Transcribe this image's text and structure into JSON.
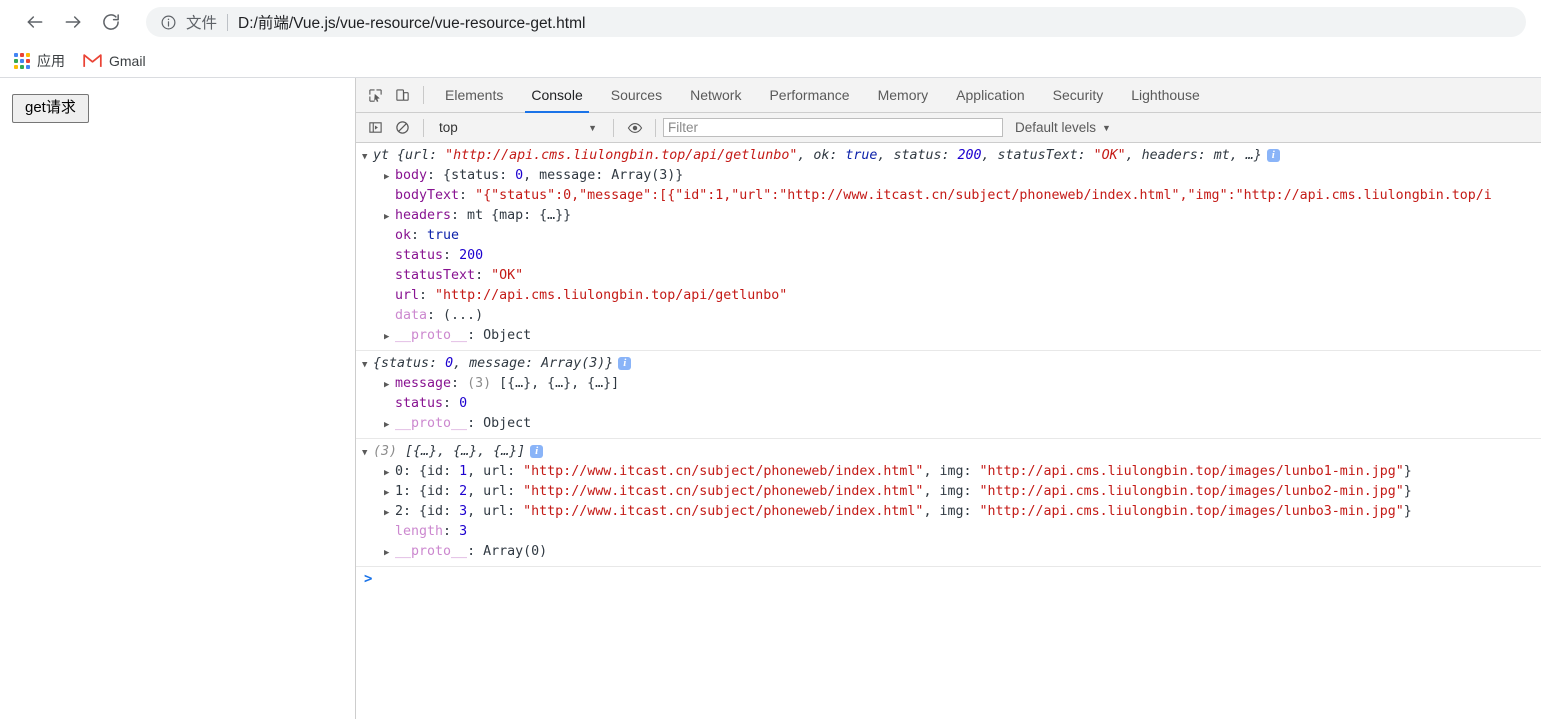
{
  "browser": {
    "nav": {
      "back_icon": "arrow-left-icon",
      "forward_icon": "arrow-right-icon",
      "reload_icon": "reload-icon"
    },
    "omnibox": {
      "info_icon": "info-circle-icon",
      "scheme_label": "文件",
      "url": "D:/前端/Vue.js/vue-resource/vue-resource-get.html"
    },
    "bookmarks": [
      {
        "icon": "apps-grid-icon",
        "label": "应用"
      },
      {
        "icon": "gmail-icon",
        "label": "Gmail"
      }
    ]
  },
  "page": {
    "button_label": "get请求"
  },
  "devtools": {
    "icons": {
      "inspect": "inspect-element-icon",
      "device": "device-toolbar-icon",
      "sidebar": "console-sidebar-icon",
      "clear": "clear-console-icon",
      "eye": "eye-icon"
    },
    "tabs": [
      {
        "label": "Elements",
        "active": false
      },
      {
        "label": "Console",
        "active": true
      },
      {
        "label": "Sources",
        "active": false
      },
      {
        "label": "Network",
        "active": false
      },
      {
        "label": "Performance",
        "active": false
      },
      {
        "label": "Memory",
        "active": false
      },
      {
        "label": "Application",
        "active": false
      },
      {
        "label": "Security",
        "active": false
      },
      {
        "label": "Lighthouse",
        "active": false
      }
    ],
    "filterbar": {
      "context": "top",
      "context_caret": "▼",
      "filter_placeholder": "Filter",
      "filter_value": "",
      "levels_label": "Default levels",
      "levels_caret": "▼"
    },
    "console": {
      "prompt_chevron": ">",
      "info_badge": "i",
      "groups": [
        {
          "header": {
            "triangle": "open",
            "name": "yt",
            "summary_parts": [
              {
                "text": "{",
                "cls": "t-plain t-ital"
              },
              {
                "text": "url",
                "cls": "t-plain t-ital"
              },
              {
                "text": ": ",
                "cls": "t-plain t-ital"
              },
              {
                "text": "\"http://api.cms.liulongbin.top/api/getlunbo\"",
                "cls": "t-str t-ital"
              },
              {
                "text": ", ",
                "cls": "t-plain t-ital"
              },
              {
                "text": "ok",
                "cls": "t-plain t-ital"
              },
              {
                "text": ": ",
                "cls": "t-plain t-ital"
              },
              {
                "text": "true",
                "cls": "t-bool t-ital"
              },
              {
                "text": ", ",
                "cls": "t-plain t-ital"
              },
              {
                "text": "status",
                "cls": "t-plain t-ital"
              },
              {
                "text": ": ",
                "cls": "t-plain t-ital"
              },
              {
                "text": "200",
                "cls": "t-num t-ital"
              },
              {
                "text": ", ",
                "cls": "t-plain t-ital"
              },
              {
                "text": "statusText",
                "cls": "t-plain t-ital"
              },
              {
                "text": ": ",
                "cls": "t-plain t-ital"
              },
              {
                "text": "\"OK\"",
                "cls": "t-str t-ital"
              },
              {
                "text": ", ",
                "cls": "t-plain t-ital"
              },
              {
                "text": "headers",
                "cls": "t-plain t-ital"
              },
              {
                "text": ": mt, …}",
                "cls": "t-plain t-ital"
              }
            ],
            "has_badge": true
          },
          "rows": [
            {
              "triangle": "closed",
              "parts": [
                {
                  "text": "body",
                  "cls": "t-prop"
                },
                {
                  "text": ": {",
                  "cls": "t-plain"
                },
                {
                  "text": "status",
                  "cls": "t-plain"
                },
                {
                  "text": ": ",
                  "cls": "t-plain"
                },
                {
                  "text": "0",
                  "cls": "t-num"
                },
                {
                  "text": ", ",
                  "cls": "t-plain"
                },
                {
                  "text": "message",
                  "cls": "t-plain"
                },
                {
                  "text": ": Array(3)}",
                  "cls": "t-plain"
                }
              ]
            },
            {
              "triangle": "blank",
              "parts": [
                {
                  "text": "bodyText",
                  "cls": "t-prop"
                },
                {
                  "text": ": ",
                  "cls": "t-plain"
                },
                {
                  "text": "\"{\"status\":0,\"message\":[{\"id\":1,\"url\":\"http://www.itcast.cn/subject/phoneweb/index.html\",\"img\":\"http://api.cms.liulongbin.top/i",
                  "cls": "t-str"
                }
              ]
            },
            {
              "triangle": "closed",
              "parts": [
                {
                  "text": "headers",
                  "cls": "t-prop"
                },
                {
                  "text": ": mt {map: {…}}",
                  "cls": "t-plain"
                }
              ]
            },
            {
              "triangle": "blank",
              "parts": [
                {
                  "text": "ok",
                  "cls": "t-prop"
                },
                {
                  "text": ": ",
                  "cls": "t-plain"
                },
                {
                  "text": "true",
                  "cls": "t-bool"
                }
              ]
            },
            {
              "triangle": "blank",
              "parts": [
                {
                  "text": "status",
                  "cls": "t-prop"
                },
                {
                  "text": ": ",
                  "cls": "t-plain"
                },
                {
                  "text": "200",
                  "cls": "t-num"
                }
              ]
            },
            {
              "triangle": "blank",
              "parts": [
                {
                  "text": "statusText",
                  "cls": "t-prop"
                },
                {
                  "text": ": ",
                  "cls": "t-plain"
                },
                {
                  "text": "\"OK\"",
                  "cls": "t-str"
                }
              ]
            },
            {
              "triangle": "blank",
              "parts": [
                {
                  "text": "url",
                  "cls": "t-prop"
                },
                {
                  "text": ": ",
                  "cls": "t-plain"
                },
                {
                  "text": "\"http://api.cms.liulongbin.top/api/getlunbo\"",
                  "cls": "t-str"
                }
              ]
            },
            {
              "triangle": "blank",
              "parts": [
                {
                  "text": "data",
                  "cls": "t-prop-d"
                },
                {
                  "text": ": (...)",
                  "cls": "t-plain"
                }
              ]
            },
            {
              "triangle": "closed",
              "parts": [
                {
                  "text": "__proto__",
                  "cls": "t-prop-d"
                },
                {
                  "text": ": Object",
                  "cls": "t-plain"
                }
              ]
            }
          ]
        },
        {
          "header": {
            "triangle": "open",
            "name": "",
            "summary_parts": [
              {
                "text": "{",
                "cls": "t-plain t-ital"
              },
              {
                "text": "status",
                "cls": "t-plain t-ital"
              },
              {
                "text": ": ",
                "cls": "t-plain t-ital"
              },
              {
                "text": "0",
                "cls": "t-num t-ital"
              },
              {
                "text": ", ",
                "cls": "t-plain t-ital"
              },
              {
                "text": "message",
                "cls": "t-plain t-ital"
              },
              {
                "text": ": Array(3)}",
                "cls": "t-plain t-ital"
              }
            ],
            "has_badge": true
          },
          "rows": [
            {
              "triangle": "closed",
              "parts": [
                {
                  "text": "message",
                  "cls": "t-prop"
                },
                {
                  "text": ": ",
                  "cls": "t-plain"
                },
                {
                  "text": "(3)",
                  "cls": "t-grey"
                },
                {
                  "text": " [{…}, {…}, {…}]",
                  "cls": "t-plain"
                }
              ]
            },
            {
              "triangle": "blank",
              "parts": [
                {
                  "text": "status",
                  "cls": "t-prop"
                },
                {
                  "text": ": ",
                  "cls": "t-plain"
                },
                {
                  "text": "0",
                  "cls": "t-num"
                }
              ]
            },
            {
              "triangle": "closed",
              "parts": [
                {
                  "text": "__proto__",
                  "cls": "t-prop-d"
                },
                {
                  "text": ": Object",
                  "cls": "t-plain"
                }
              ]
            }
          ]
        },
        {
          "header": {
            "triangle": "open",
            "name": "",
            "summary_parts": [
              {
                "text": "(3)",
                "cls": "t-grey t-ital"
              },
              {
                "text": " [{…}, {…}, {…}]",
                "cls": "t-plain t-ital"
              }
            ],
            "has_badge": true
          },
          "rows": [
            {
              "triangle": "closed",
              "parts": [
                {
                  "text": "0",
                  "cls": "t-plain"
                },
                {
                  "text": ": {",
                  "cls": "t-plain"
                },
                {
                  "text": "id",
                  "cls": "t-plain"
                },
                {
                  "text": ": ",
                  "cls": "t-plain"
                },
                {
                  "text": "1",
                  "cls": "t-num"
                },
                {
                  "text": ", ",
                  "cls": "t-plain"
                },
                {
                  "text": "url",
                  "cls": "t-plain"
                },
                {
                  "text": ": ",
                  "cls": "t-plain"
                },
                {
                  "text": "\"http://www.itcast.cn/subject/phoneweb/index.html\"",
                  "cls": "t-str"
                },
                {
                  "text": ", ",
                  "cls": "t-plain"
                },
                {
                  "text": "img",
                  "cls": "t-plain"
                },
                {
                  "text": ": ",
                  "cls": "t-plain"
                },
                {
                  "text": "\"http://api.cms.liulongbin.top/images/lunbo1-min.jpg\"",
                  "cls": "t-str"
                },
                {
                  "text": "}",
                  "cls": "t-plain"
                }
              ]
            },
            {
              "triangle": "closed",
              "parts": [
                {
                  "text": "1",
                  "cls": "t-plain"
                },
                {
                  "text": ": {",
                  "cls": "t-plain"
                },
                {
                  "text": "id",
                  "cls": "t-plain"
                },
                {
                  "text": ": ",
                  "cls": "t-plain"
                },
                {
                  "text": "2",
                  "cls": "t-num"
                },
                {
                  "text": ", ",
                  "cls": "t-plain"
                },
                {
                  "text": "url",
                  "cls": "t-plain"
                },
                {
                  "text": ": ",
                  "cls": "t-plain"
                },
                {
                  "text": "\"http://www.itcast.cn/subject/phoneweb/index.html\"",
                  "cls": "t-str"
                },
                {
                  "text": ", ",
                  "cls": "t-plain"
                },
                {
                  "text": "img",
                  "cls": "t-plain"
                },
                {
                  "text": ": ",
                  "cls": "t-plain"
                },
                {
                  "text": "\"http://api.cms.liulongbin.top/images/lunbo2-min.jpg\"",
                  "cls": "t-str"
                },
                {
                  "text": "}",
                  "cls": "t-plain"
                }
              ]
            },
            {
              "triangle": "closed",
              "parts": [
                {
                  "text": "2",
                  "cls": "t-plain"
                },
                {
                  "text": ": {",
                  "cls": "t-plain"
                },
                {
                  "text": "id",
                  "cls": "t-plain"
                },
                {
                  "text": ": ",
                  "cls": "t-plain"
                },
                {
                  "text": "3",
                  "cls": "t-num"
                },
                {
                  "text": ", ",
                  "cls": "t-plain"
                },
                {
                  "text": "url",
                  "cls": "t-plain"
                },
                {
                  "text": ": ",
                  "cls": "t-plain"
                },
                {
                  "text": "\"http://www.itcast.cn/subject/phoneweb/index.html\"",
                  "cls": "t-str"
                },
                {
                  "text": ", ",
                  "cls": "t-plain"
                },
                {
                  "text": "img",
                  "cls": "t-plain"
                },
                {
                  "text": ": ",
                  "cls": "t-plain"
                },
                {
                  "text": "\"http://api.cms.liulongbin.top/images/lunbo3-min.jpg\"",
                  "cls": "t-str"
                },
                {
                  "text": "}",
                  "cls": "t-plain"
                }
              ]
            },
            {
              "triangle": "blank",
              "parts": [
                {
                  "text": "length",
                  "cls": "t-prop-d"
                },
                {
                  "text": ": ",
                  "cls": "t-plain"
                },
                {
                  "text": "3",
                  "cls": "t-num"
                }
              ]
            },
            {
              "triangle": "closed",
              "parts": [
                {
                  "text": "__proto__",
                  "cls": "t-prop-d"
                },
                {
                  "text": ": Array(0)",
                  "cls": "t-plain"
                }
              ]
            }
          ]
        }
      ]
    }
  }
}
